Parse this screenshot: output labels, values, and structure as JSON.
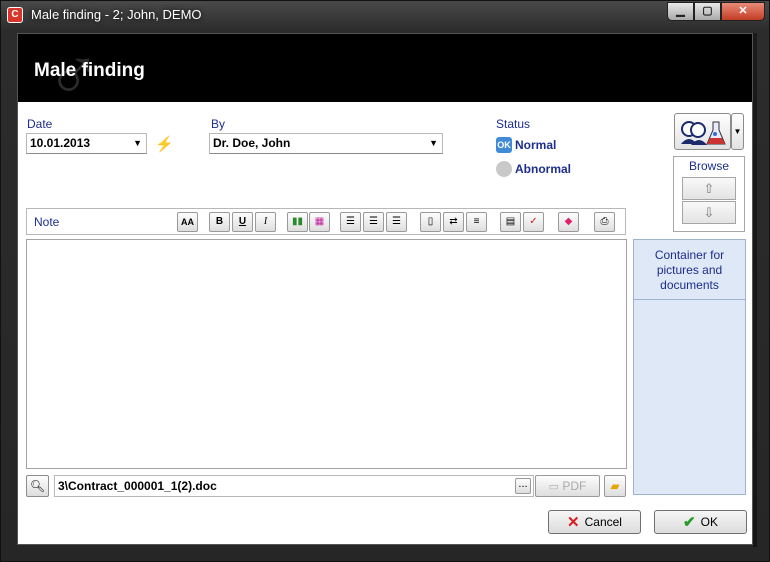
{
  "window": {
    "title": "Male finding - 2; John, DEMO",
    "app_icon": "app-logo-icon",
    "buttons": {
      "minimize": "▁",
      "maximize": "▢",
      "close": "✕"
    }
  },
  "header": {
    "title": "Male finding",
    "symbol": "♂"
  },
  "form": {
    "date_label": "Date",
    "date_value": "10.01.2013",
    "by_label": "By",
    "by_value": "Dr. Doe, John",
    "status_label": "Status",
    "status_ok_badge": "OK",
    "status_normal": "Normal",
    "status_abnormal": "Abnormal",
    "status_selected": "Normal"
  },
  "browse": {
    "title": "Browse",
    "up": "⇧",
    "down": "⇩"
  },
  "toolbar": {
    "note_label": "Note",
    "buttons": [
      {
        "name": "font-icon",
        "glyph": "AA"
      },
      {
        "name": "bold-icon",
        "glyph": "B"
      },
      {
        "name": "underline-icon",
        "glyph": "U"
      },
      {
        "name": "italic-icon",
        "glyph": "I"
      },
      {
        "name": "pencils-icon",
        "glyph": "▮▮"
      },
      {
        "name": "color-palette-icon",
        "glyph": "▦"
      },
      {
        "name": "align-left-icon",
        "glyph": "☰"
      },
      {
        "name": "align-center-icon",
        "glyph": "☰"
      },
      {
        "name": "align-right-icon",
        "glyph": "☰"
      },
      {
        "name": "new-document-icon",
        "glyph": "▯"
      },
      {
        "name": "insert-link-icon",
        "glyph": "⇄"
      },
      {
        "name": "insert-text-icon",
        "glyph": "≡"
      },
      {
        "name": "clipboard-icon",
        "glyph": "▤"
      },
      {
        "name": "spellcheck-icon",
        "glyph": "✓"
      },
      {
        "name": "eraser-icon",
        "glyph": "◆"
      },
      {
        "name": "print-icon",
        "glyph": "⎙"
      }
    ]
  },
  "container": {
    "title": "Container for pictures and documents"
  },
  "file": {
    "path": "3\\Contract_000001_1(2).doc",
    "browse_label": "...",
    "pdf_label": "PDF"
  },
  "actions": {
    "cancel_label": "Cancel",
    "ok_label": "OK"
  },
  "colors": {
    "header_bg": "#000000",
    "label_blue": "#1d2e8c",
    "status_ok": "#3f8bd6",
    "container_bg": "#dfe8f7",
    "cancel_x": "#d42020",
    "ok_check": "#2a9a2a"
  }
}
